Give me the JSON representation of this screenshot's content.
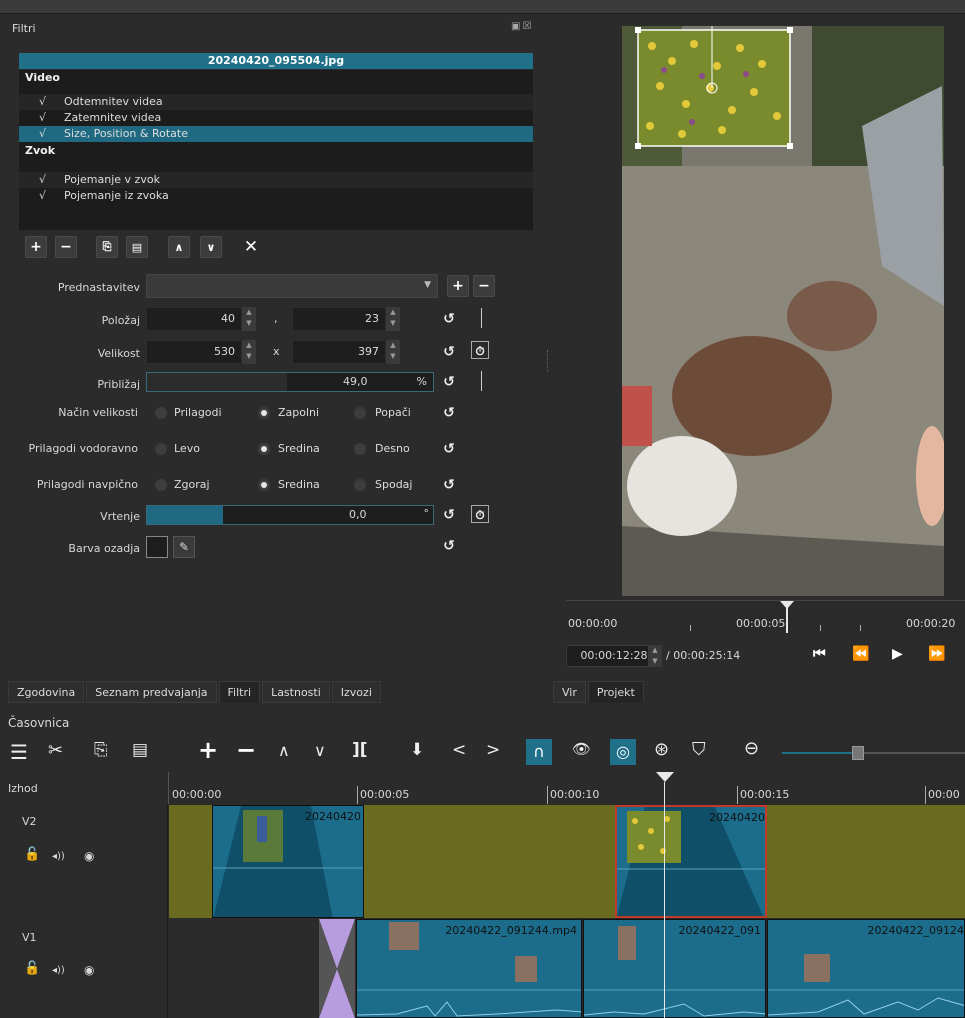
{
  "filters_panel": {
    "title": "Filtri",
    "file_name": "20240420_095504.jpg",
    "categories": {
      "video": "Video",
      "audio": "Zvok"
    },
    "video_filters": [
      "Odtemnitev videa",
      "Zatemnitev videa",
      "Size, Position & Rotate"
    ],
    "audio_filters": [
      "Pojemanje v zvok",
      "Pojemanje iz zvoka"
    ],
    "check_mark": "√",
    "preset_label": "Prednastavitev",
    "position_label": "Položaj",
    "position_x": "40",
    "position_sep": ",",
    "position_y": "23",
    "size_label": "Velikost",
    "size_w": "530",
    "size_sep": "x",
    "size_h": "397",
    "zoom_label": "Približaj",
    "zoom_value": "49,0",
    "zoom_unit": "%",
    "zoom_fraction": 0.49,
    "size_mode_label": "Način velikosti",
    "size_mode_options": [
      "Prilagodi",
      "Zapolni",
      "Popači"
    ],
    "h_align_label": "Prilagodi vodoravno",
    "h_align_options": [
      "Levo",
      "Sredina",
      "Desno"
    ],
    "v_align_label": "Prilagodi navpično",
    "v_align_options": [
      "Zgoraj",
      "Sredina",
      "Spodaj"
    ],
    "rotation_label": "Vrtenje",
    "rotation_value": "0,0",
    "rotation_unit": "°",
    "bg_color_label": "Barva ozadja",
    "bottom_tabs": [
      "Zgodovina",
      "Seznam predvajanja",
      "Filtri",
      "Lastnosti",
      "Izvozi"
    ]
  },
  "player": {
    "ruler_ticks": [
      "00:00:00",
      "00:00:05",
      "00:00:20"
    ],
    "current_time": "00:00:12:28",
    "total_time": "/ 00:00:25:14",
    "tabs": [
      "Vir",
      "Projekt"
    ]
  },
  "timeline": {
    "title": "Časovnica",
    "output_label": "Izhod",
    "ruler_ticks": [
      "00:00:00",
      "00:00:05",
      "00:00:10",
      "00:00:15",
      "00:00"
    ],
    "tracks": [
      {
        "name": "V2",
        "clips": [
          "20240420",
          "20240420"
        ]
      },
      {
        "name": "V1",
        "clips": [
          "20240422_091244.mp4",
          "20240422_091",
          "20240422_09124"
        ]
      }
    ]
  },
  "colors": {
    "accent": "#1f7088",
    "track_v2": "#6b6b1f",
    "clip": "#1b6d8b",
    "selection": "#c0392b"
  }
}
